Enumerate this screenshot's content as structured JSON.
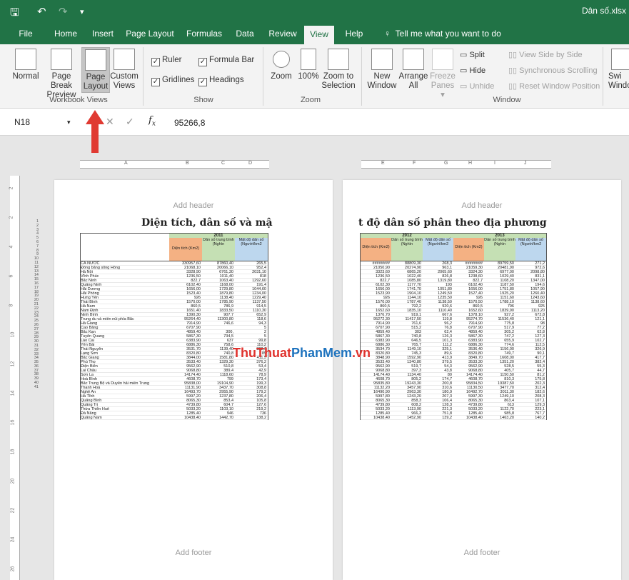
{
  "title": "Dân số.xlsx",
  "menu": [
    "File",
    "Home",
    "Insert",
    "Page Layout",
    "Formulas",
    "Data",
    "Review",
    "View",
    "Help"
  ],
  "tell_me": "Tell me what you want to do",
  "ribbon": {
    "normal": "Normal",
    "page_break": "Page Break",
    "page_break2": "Preview",
    "page_layout": "Page",
    "page_layout2": "Layout",
    "custom": "Custom",
    "custom2": "Views",
    "group1": "Workbook Views",
    "ruler": "Ruler",
    "formula_bar": "Formula Bar",
    "gridlines": "Gridlines",
    "headings": "Headings",
    "group2": "Show",
    "zoom": "Zoom",
    "zoom100": "100%",
    "zoom_sel": "Zoom to",
    "zoom_sel2": "Selection",
    "group3": "Zoom",
    "new_window": "New",
    "new_window2": "Window",
    "arrange": "Arrange",
    "arrange2": "All",
    "freeze": "Freeze",
    "freeze2": "Panes ▾",
    "split": "Split",
    "hide": "Hide",
    "unhide": "Unhide",
    "side_by_side": "View Side by Side",
    "sync_scroll": "Synchronous Scrolling",
    "reset_pos": "Reset Window Position",
    "switch": "Swi",
    "switch2": "Windo",
    "group4": "Window"
  },
  "name_box": "N18",
  "formula_value": "95266,8",
  "col_labels_left": [
    "A",
    "B",
    "C",
    "D"
  ],
  "col_labels_right": [
    "E",
    "F",
    "G",
    "H",
    "I",
    "J"
  ],
  "page_left": {
    "header": "Add header",
    "footer": "Add footer",
    "title": "Diện tích, dân số và mật"
  },
  "page_right": {
    "header": "Add header",
    "footer": "Add footer",
    "title": "t độ dân số phân theo địa phương"
  },
  "table_left": {
    "year": "2011",
    "h1": "Diện tích (Km2)",
    "h2": "Dân số trung bình (Nghìn",
    "h3": "Mật độ dân số (Người/km2",
    "rows": [
      [
        "CẢ NƯỚC",
        "330957,60",
        "87860,40",
        "265,5"
      ],
      [
        "Đồng bằng sông Hồng",
        "21068,10",
        "20066,10",
        "952,4"
      ],
      [
        "Hà Nội",
        "3328,90",
        "6761,30",
        "2031,10"
      ],
      [
        "Vĩnh Phúc",
        "1236,50",
        "1011,40",
        "818"
      ],
      [
        "Bắc Ninh",
        "822,7",
        "1063,40",
        "1292,60"
      ],
      [
        "Quảng Ninh",
        "6102,40",
        "1168,00",
        "191,4"
      ],
      [
        "Hải Dương",
        "1656,00",
        "1729,80",
        "1044,60"
      ],
      [
        "Hải Phòng",
        "1523,40",
        "1879,80",
        "1234,00"
      ],
      [
        "Hưng Yên",
        "926",
        "1138,40",
        "1229,40"
      ],
      [
        "Thái Bình",
        "1570,00",
        "1785,90",
        "1137,50"
      ],
      [
        "Hà Nam",
        "860,5",
        "786,9",
        "914,5"
      ],
      [
        "Nam Định",
        "1651,40",
        "1833,50",
        "1110,30"
      ],
      [
        "Ninh Bình",
        "1390,30",
        "907,7",
        "652,9"
      ],
      [
        "Trung du và miền núi phía Bắc",
        "95264,40",
        "11300,80",
        "118,6"
      ],
      [
        "Hà Giang",
        "7914,90",
        "746,6",
        "94,3"
      ],
      [
        "Cao Bằng",
        "6707,90",
        "",
        "5"
      ],
      [
        "Bắc Kạn",
        "4859,40",
        "300,",
        "2"
      ],
      [
        "Tuyên Quang",
        "5867,30",
        "734,5",
        "5"
      ],
      [
        "Lào Cai",
        "6383,90",
        "637",
        "99,8"
      ],
      [
        "Yên Bái",
        "6886,30",
        "758,6",
        "110,2"
      ],
      [
        "Thái Nguyên",
        "3531,70",
        "1139,40",
        "322,6"
      ],
      [
        "Lạng Sơn",
        "8320,80",
        "740,8",
        "89"
      ],
      [
        "Bắc Giang",
        "3844,00",
        "1581,80",
        "411,5"
      ],
      [
        "Phú Thọ",
        "3533,40",
        "1329,30",
        "376,2"
      ],
      [
        "Điện Biên",
        "9562,90",
        "510,8",
        "53,4"
      ],
      [
        "Lai Châu",
        "9068,80",
        "389,4",
        "42,9"
      ],
      [
        "Sơn La",
        "14174,40",
        "1118,60",
        "78,9"
      ],
      [
        "Hoà Bình",
        "4608,70",
        "799",
        "173,4"
      ],
      [
        "Bắc Trung Bộ và Duyên hải miền Trung",
        "95838,00",
        "19104,90",
        "199,3"
      ],
      [
        "Thanh Hoá",
        "11131,90",
        "3437,70",
        "308,8"
      ],
      [
        "Nghệ An",
        "16493,70",
        "2955,90",
        "179,2"
      ],
      [
        "Hà Tĩnh",
        "5997,20",
        "1237,80",
        "206,4"
      ],
      [
        "Quảng Bình",
        "8065,30",
        "853,4",
        "105,8"
      ],
      [
        "Quảng Trị",
        "4739,80",
        "604,7",
        "127,6"
      ],
      [
        "Thừa Thiên Huế",
        "5033,20",
        "1103,10",
        "219,2"
      ],
      [
        "Đà Nẵng",
        "1285,40",
        "946",
        "736"
      ],
      [
        "Quảng Nam",
        "10438,40",
        "1442,70",
        "138,2"
      ]
    ]
  },
  "table_right": {
    "year1": "2012",
    "year2": "2013",
    "h1": "Diện tích (Km2)",
    "h2": "Dân số trung bình (Nghìn",
    "h3": "Mật độ dân số (Người/km2",
    "rows": [
      [
        "########",
        "88809,30",
        "268,3",
        "########",
        "89759,50",
        "271,2"
      ],
      [
        "21050,90",
        "20274,90",
        "963,1",
        "21059,30",
        "20481,90",
        "972,6"
      ],
      [
        "3323,60",
        "6865,20",
        "2065,60",
        "3324,30",
        "6977,00",
        "2098,80"
      ],
      [
        "1236,50",
        "1022,40",
        "826,8",
        "1238,60",
        "1029,40",
        "831,1"
      ],
      [
        "822,7",
        "1085,80",
        "1319,80",
        "822,7",
        "1108,20",
        "1347,00"
      ],
      [
        "6102,30",
        "1177,70",
        "193",
        "6102,40",
        "1187,50",
        "194,6"
      ],
      [
        "1656,00",
        "1741,70",
        "1051,80",
        "1656,00",
        "1751,80",
        "1057,90"
      ],
      [
        "1523,90",
        "1904,10",
        "1249,50",
        "1527,40",
        "1925,20",
        "1260,40"
      ],
      [
        "926",
        "1144,10",
        "1235,50",
        "926",
        "1151,60",
        "1243,60"
      ],
      [
        "1570,00",
        "1787,40",
        "1138,50",
        "1570,50",
        "1788,10",
        "1138,60"
      ],
      [
        "860,5",
        "792,2",
        "920,6",
        "860,5",
        "796",
        "925"
      ],
      [
        "1652,60",
        "1835,10",
        "1110,40",
        "1652,60",
        "1839,90",
        "1113,20"
      ],
      [
        "1376,70",
        "919,1",
        "667,6",
        "1378,10",
        "927,2",
        "672,8"
      ],
      [
        "95272,30",
        "11417,50",
        "119,8",
        "95274,70",
        "11536,40",
        "121,1"
      ],
      [
        "7914,90",
        "761,6",
        "96,2",
        "7914,90",
        "775,8",
        "98"
      ],
      [
        "6707,90",
        "515,2",
        "76,8",
        "6707,90",
        "517,9",
        "77,2"
      ],
      [
        "4859,40",
        "303",
        "62,4",
        "4859,40",
        "305,2",
        "62,8"
      ],
      [
        "5867,30",
        "740,8",
        "126,3",
        "5867,30",
        "747,2",
        "127,3"
      ],
      [
        "6383,90",
        "646,5",
        "101,3",
        "6383,90",
        "655,9",
        "102,7"
      ],
      [
        "6886,30",
        "765,7",
        "111,2",
        "6886,30",
        "774,6",
        "112,5"
      ],
      [
        "3534,70",
        "1149,10",
        "325,1",
        "3536,40",
        "1156,00",
        "326,9"
      ],
      [
        "8320,80",
        "745,3",
        "89,6",
        "8320,80",
        "749,7",
        "90,1"
      ],
      [
        "3848,90",
        "1592,90",
        "413,9",
        "3849,70",
        "1608,00",
        "417,7"
      ],
      [
        "3533,40",
        "1340,80",
        "379,5",
        "3533,30",
        "1351,20",
        "382,4"
      ],
      [
        "9562,90",
        "519,7",
        "54,3",
        "9562,90",
        "528,5",
        "55,3"
      ],
      [
        "9068,80",
        "397,3",
        "43,8",
        "9068,80",
        "405,7",
        "44,7"
      ],
      [
        "14174,40",
        "1134,40",
        "80",
        "14174,40",
        "1150,50",
        "81,2"
      ],
      [
        "4608,70",
        "805,2",
        "174,7",
        "4608,70",
        "810,3",
        "175,8"
      ],
      [
        "95835,80",
        "19243,30",
        "200,8",
        "95834,50",
        "19387,50",
        "202,3"
      ],
      [
        "11132,20",
        "3457,90",
        "310,6",
        "11130,50",
        "3477,70",
        "312,4"
      ],
      [
        "16490,90",
        "2963,30",
        "180,9",
        "16492,70",
        "3011,30",
        "182,6"
      ],
      [
        "5997,80",
        "1243,20",
        "207,3",
        "5997,30",
        "1249,10",
        "208,3"
      ],
      [
        "8065,30",
        "858,3",
        "106,4",
        "8065,30",
        "863,4",
        "107,1"
      ],
      [
        "4739,80",
        "608,2",
        "128,3",
        "4739,80",
        "613",
        "129,3"
      ],
      [
        "5033,20",
        "1113,90",
        "221,3",
        "5033,20",
        "1122,70",
        "223,1"
      ],
      [
        "1285,40",
        "966,3",
        "751,8",
        "1285,40",
        "985,8",
        "767,7"
      ],
      [
        "10438,40",
        "1452,90",
        "139,2",
        "10438,40",
        "1463,20",
        "140,2"
      ]
    ]
  },
  "watermark_a": "ThuThuat",
  "watermark_b": "PhanMem",
  "watermark_c": ".vn",
  "row_numbers": [
    "1",
    "2",
    "3",
    "4",
    "5",
    "6",
    "7",
    "8",
    "9",
    "10",
    "11",
    "12",
    "13",
    "14",
    "15",
    "16",
    "17",
    "18",
    "19",
    "20",
    "21",
    "22",
    "23",
    "24",
    "25",
    "26",
    "27",
    "28",
    "29",
    "30",
    "31",
    "32",
    "33",
    "34",
    "35",
    "36",
    "37",
    "38",
    "39",
    "40",
    "41"
  ],
  "vruler_labels": [
    "2",
    "2",
    "4",
    "6",
    "8",
    "10",
    "12",
    "14",
    "16",
    "18",
    "20",
    "22",
    "24",
    "26"
  ],
  "colors": {
    "excel_green": "#217346",
    "header_orange": "#f4b183",
    "header_green": "#c5e0b4",
    "header_blue": "#bdd7ee",
    "arrow": "#e03a32"
  },
  "icons": [
    "save-icon",
    "undo-icon",
    "redo-icon",
    "lightbulb-icon",
    "fx-icon",
    "arrow-up-icon"
  ]
}
